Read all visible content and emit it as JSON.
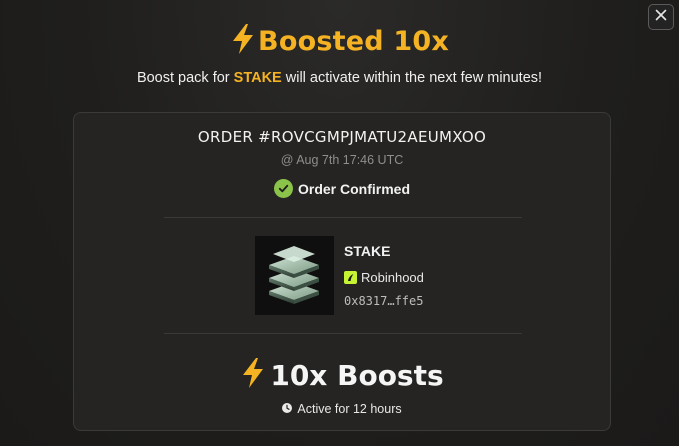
{
  "header": {
    "title": "Boosted 10x",
    "subtitle_prefix": "Boost pack for ",
    "subtitle_token": "STAKE",
    "subtitle_suffix": " will activate within the next few minutes!",
    "close_icon": "close-icon"
  },
  "order": {
    "id": "ORDER #ROVCGMPJMATU2AEUMXOO",
    "date": "@ Aug 7th 17:46 UTC",
    "status": "Order Confirmed",
    "status_icon": "check-circle-icon"
  },
  "token": {
    "name": "STAKE",
    "chain": "Robinhood",
    "chain_icon": "robinhood-icon",
    "address": "0x8317…ffe5",
    "image": "token-logo-stacked-layers"
  },
  "boost": {
    "label": "10x Boosts",
    "icon": "lightning-bolt-icon",
    "duration": "Active for 12 hours",
    "duration_icon": "clock-icon"
  },
  "colors": {
    "accent": "#f5b323",
    "success": "#8bc34a",
    "chain": "#c6f432",
    "background": "#1f1e1c",
    "card": "#252422"
  }
}
